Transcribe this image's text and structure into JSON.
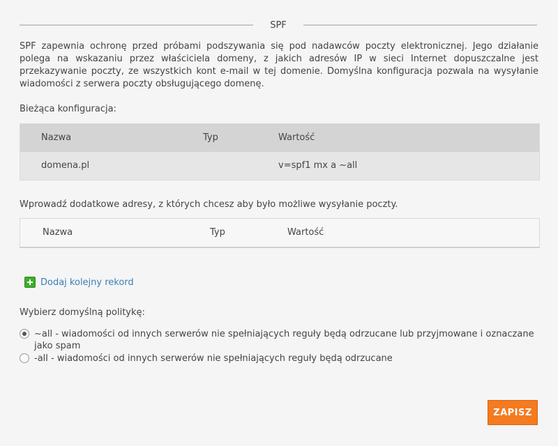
{
  "section": {
    "title": "SPF"
  },
  "description": "SPF zapewnia ochronę przed próbami podszywania się pod nadawców poczty elektronicznej. Jego działanie polega na wskazaniu przez właściciela domeny, z jakich adresów IP w sieci Internet dopuszczalne jest przekazywanie poczty, ze wszystkich kont e-mail w tej domenie. Domyślna konfiguracja pozwala na wysyłanie wiadomości z serwera poczty obsługującego domenę.",
  "current_config": {
    "label": "Bieżąca konfiguracja:",
    "columns": {
      "name": "Nazwa",
      "type": "Typ",
      "value": "Wartość"
    },
    "rows": [
      {
        "name": "domena.pl",
        "type": "",
        "value": "v=spf1 mx a ~all"
      }
    ]
  },
  "additional": {
    "label": "Wprowadź dodatkowe adresy, z których chcesz aby było możliwe wysyłanie poczty.",
    "columns": {
      "name": "Nazwa",
      "type": "Typ",
      "value": "Wartość"
    }
  },
  "add_record": {
    "label": "Dodaj kolejny rekord",
    "icon": "plus-icon"
  },
  "policy": {
    "label": "Wybierz domyślną politykę:",
    "options": [
      {
        "label": "~all - wiadomości od innych serwerów nie spełniających reguły będą odrzucane lub przyjmowane i oznaczane jako spam",
        "checked": true
      },
      {
        "label": "-all - wiadomości od innych serwerów nie spełniających reguły będą odrzucane",
        "checked": false
      }
    ]
  },
  "save": {
    "label": "ZAPISZ"
  },
  "colors": {
    "accent": "#f47b20",
    "link": "#3a7fb8",
    "add_icon": "#3fae29"
  }
}
